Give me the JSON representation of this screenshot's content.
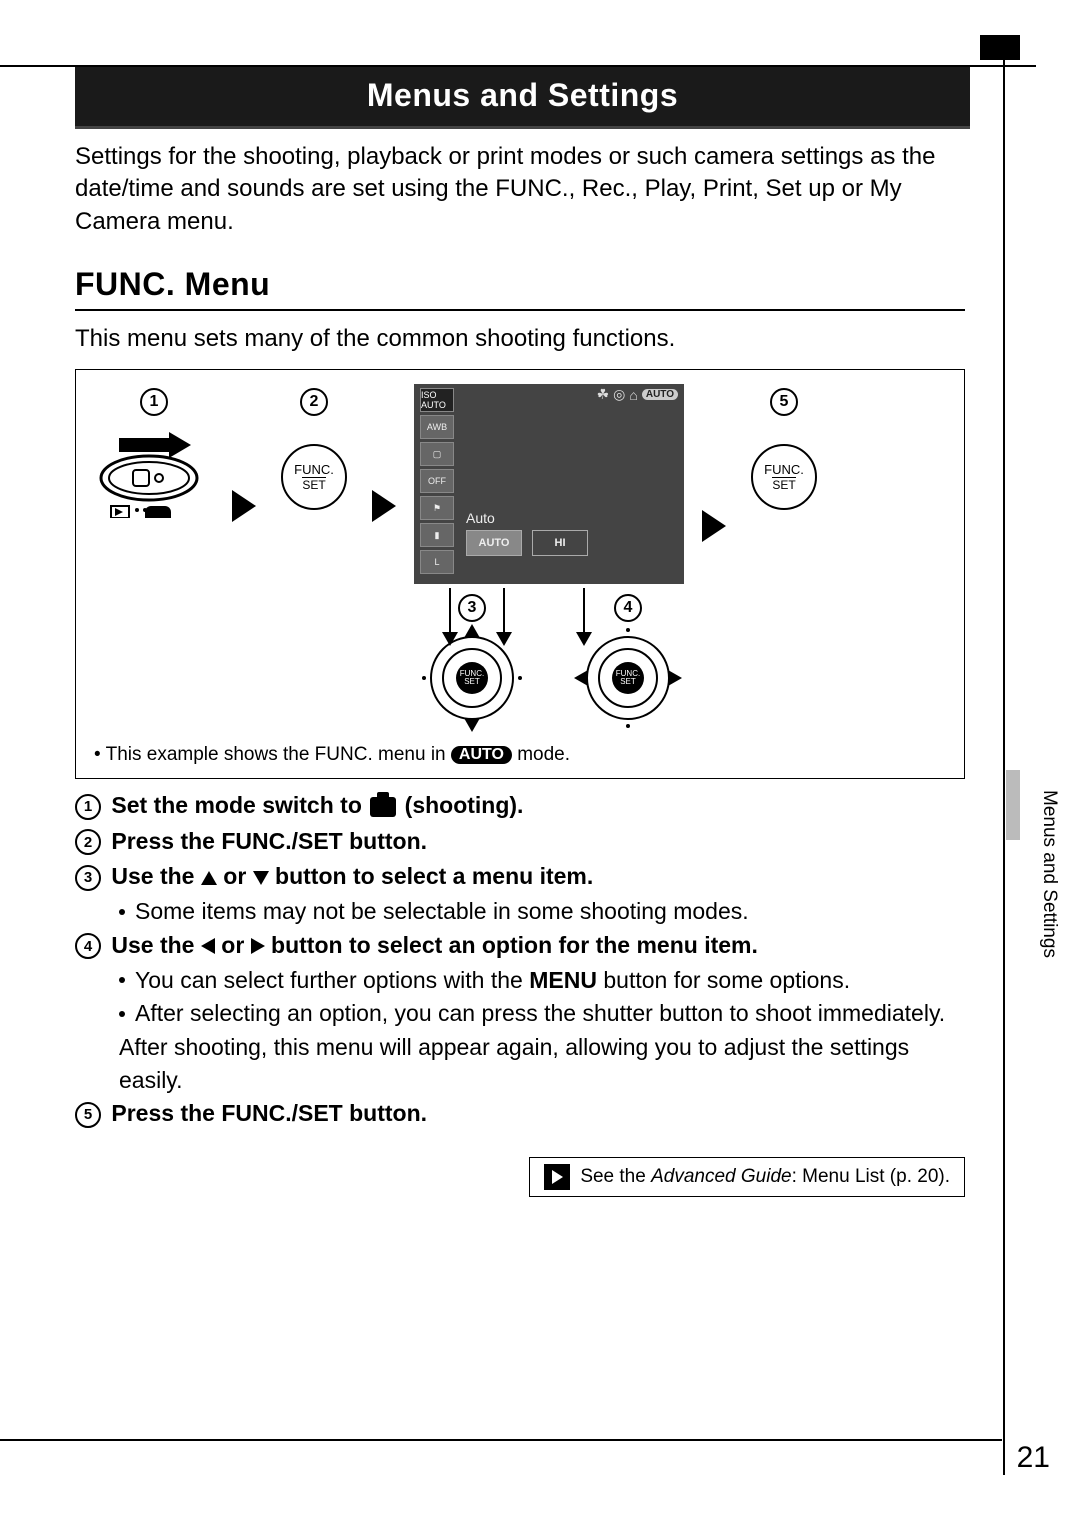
{
  "title_bar": "Menus and Settings",
  "intro": "Settings for the shooting, playback or print modes or such camera settings as the date/time and sounds are set using the FUNC., Rec., Play, Print, Set up or My Camera menu.",
  "section_heading": "FUNC. Menu",
  "section_sub": "This menu sets many of the common shooting functions.",
  "func_label_top": "FUNC.",
  "func_label_bottom": "SET",
  "screen": {
    "sidebar": [
      "ISO AUTO",
      "AWB",
      "▢",
      "OFF",
      "⚑",
      "▮",
      "L"
    ],
    "top_auto": "AUTO",
    "label": "Auto",
    "options": [
      "AUTO",
      "HI"
    ]
  },
  "caption_prefix": "• This example shows the FUNC. menu in ",
  "caption_badge": "AUTO",
  "caption_suffix": " mode.",
  "steps": {
    "s1_a": "Set the mode switch to ",
    "s1_b": " (shooting).",
    "s2": "Press the FUNC./SET button.",
    "s3": "Use the ",
    "s3_mid": " or ",
    "s3_end": " button to select a menu item.",
    "s3_sub": "Some items may not be selectable in some shooting modes.",
    "s4": "Use the ",
    "s4_mid": " or ",
    "s4_end": " button to select an option for the menu item.",
    "s4_sub1a": "You can select further options with the ",
    "s4_sub1b": "MENU",
    "s4_sub1c": " button for some options.",
    "s4_sub2": "After selecting an option, you can press the shutter button to shoot immediately. After shooting, this menu will appear again, allowing you to adjust the settings easily.",
    "s5": "Press the FUNC./SET button."
  },
  "see_also_a": "See the ",
  "see_also_b": "Advanced Guide",
  "see_also_c": ": Menu List (p. 20).",
  "side_label": "Menus and Settings",
  "page_number": "21"
}
